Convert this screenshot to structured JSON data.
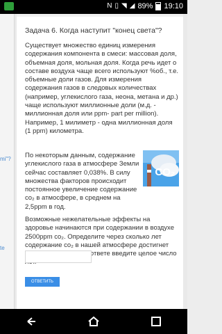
{
  "status": {
    "battery_percent": "89%",
    "time": "19:10",
    "icons": [
      "notification-icon",
      "nfc-icon",
      "vibrate-icon",
      "wifi-icon",
      "signal-icon",
      "battery-icon"
    ]
  },
  "task": {
    "title": "Задача 6. Когда наступит \"конец света\"?",
    "p1": "Существует множество единиц измерения содержания компонента в смеси: массовая доля, объемная доля, мольная доля. Когда речь идет о составе воздуха чаще всего используют %об., т.е. объемные доли газов. Для измерения содержания газов в следовых количествах (например, углекислого газа, неона, метана и др.) чаще используют миллионные доли (м.д. - миллионная доля или ppm- part per million). Например, 1 милиметр - одна миллионная доля (1 ppm) километра.",
    "p2": "По некоторым данным, содержание углекислого газа в атмосфере Земли сейчас составляет 0,038%. В силу множества факторов происходит постоянное увеличение содержание co₂ в атмосфере, в среднем на 2,5ppm в год.",
    "p3": "Возможные нежелательные эффекты на здоровье начинаются при содержании в воздухе 2500ppm co₂. Определите через сколько лет содержание co₂ в нашей атмосфере достигнет отметки 2500ppm . В ответе введите целое число лет.",
    "image_text": "CO₂",
    "answer_value": "",
    "submit_label": "ОТВЕТИТЬ"
  },
  "left_fragments": [
    "mi\"?",
    "te"
  ],
  "colors": {
    "submit": "#3a8ee6",
    "sky": "#4aa3e8",
    "co2_text": "#ffffff"
  }
}
